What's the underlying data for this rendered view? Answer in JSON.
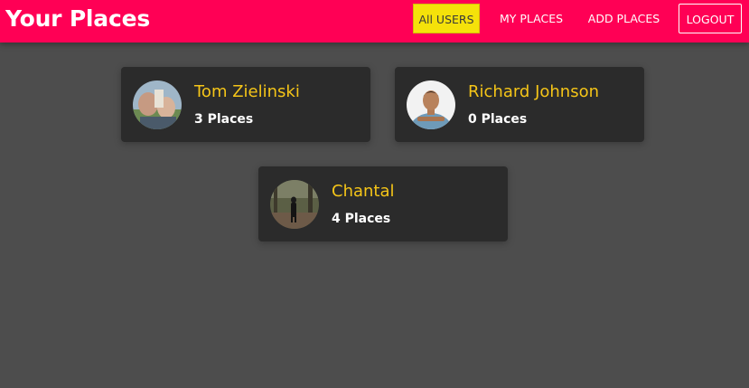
{
  "header": {
    "title": "Your Places",
    "background": "#ff0055"
  },
  "nav": {
    "items": [
      {
        "label": "All USERS",
        "active": true
      },
      {
        "label": "MY PLACES",
        "active": false
      },
      {
        "label": "ADD PLACES",
        "active": false
      },
      {
        "label": "LOGOUT",
        "active": false
      }
    ],
    "active_color": "#f5e20a"
  },
  "users": [
    {
      "name": "Tom Zielinski",
      "places": "3 Places",
      "avatar": "user-photo-icon"
    },
    {
      "name": "Richard Johnson",
      "places": "0 Places",
      "avatar": "user-photo-icon"
    },
    {
      "name": "Chantal",
      "places": "4 Places",
      "avatar": "user-photo-icon"
    }
  ],
  "colors": {
    "page_background": "#4d4d4d",
    "card_background": "#2b2b2b",
    "name_color": "#f5c518"
  }
}
